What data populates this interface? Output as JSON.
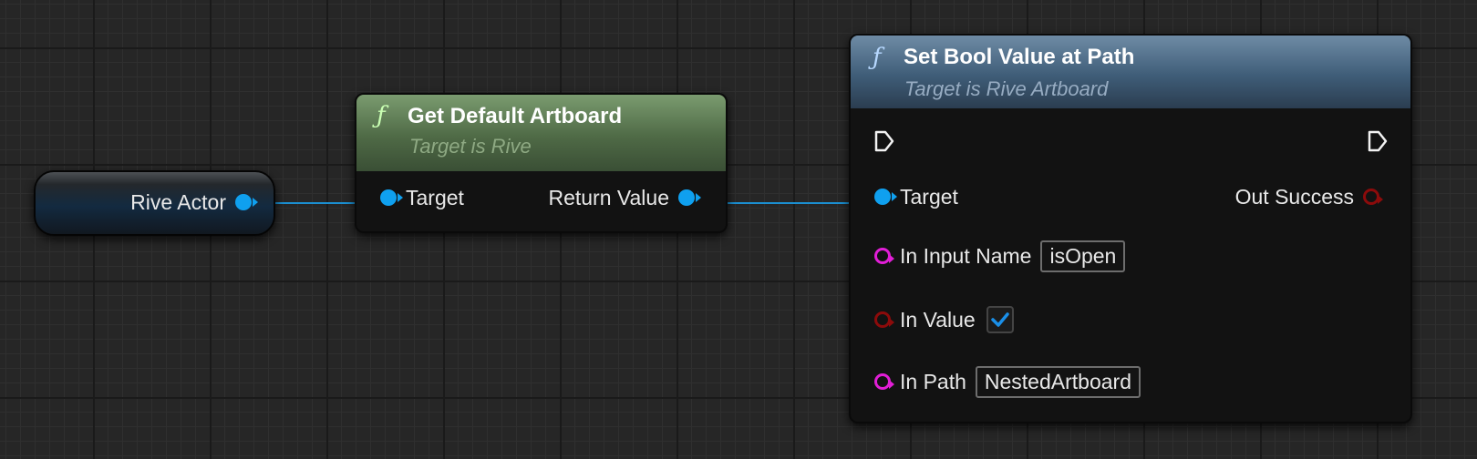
{
  "nodes": {
    "rive_actor": {
      "pin_label": "Rive Actor"
    },
    "get_default_artboard": {
      "title": "Get Default Artboard",
      "subtitle": "Target is Rive",
      "input_target_label": "Target",
      "output_return_label": "Return Value"
    },
    "set_bool_value": {
      "title": "Set Bool Value at Path",
      "subtitle": "Target is Rive Artboard",
      "target_label": "Target",
      "out_success_label": "Out Success",
      "in_input_name_label": "In Input Name",
      "in_input_name_value": "isOpen",
      "in_value_label": "In Value",
      "in_value_checked": true,
      "in_path_label": "In Path",
      "in_path_value": "NestedArtboard"
    }
  },
  "colors": {
    "object_pin": "#0fa0ef",
    "string_pin": "#e11ed6",
    "bool_pin": "#8c0b0b",
    "wire": "#1b8fd1",
    "function_header_green": "#4f6a46",
    "function_header_blue": "#3f5d78"
  },
  "icons": [
    "function-icon",
    "exec-pin-icon",
    "checkmark-icon"
  ]
}
